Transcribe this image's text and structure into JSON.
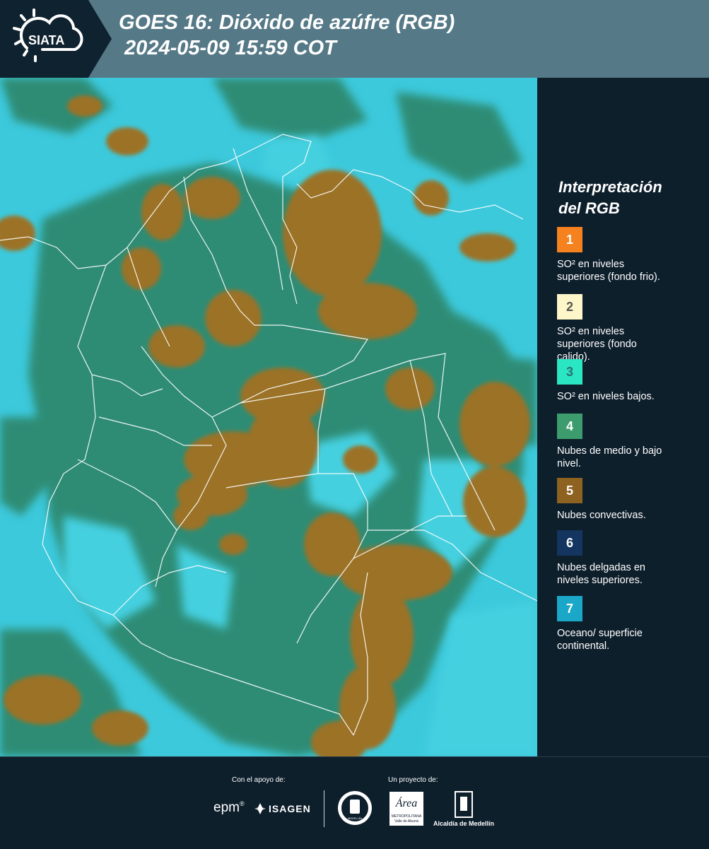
{
  "header": {
    "logo_text": "SIATA",
    "title_line1": "GOES 16: Dióxido de azúfre (RGB)",
    "title_line2": " 2024-05-09 15:59 COT"
  },
  "legend": {
    "title_line1": "Interpretación",
    "title_line2": "del RGB",
    "items": [
      {
        "number": "1",
        "color": "#f6821f",
        "text_color": "#ffffff",
        "label_line1": "SO² en niveles",
        "label_line2": "superiores (fondo frio)."
      },
      {
        "number": "2",
        "color": "#fdf6c8",
        "text_color": "#555555",
        "label_line1": "SO² en niveles",
        "label_line2": "superiores (fondo",
        "label_line3": "calido)."
      },
      {
        "number": "3",
        "color": "#2ae6c2",
        "text_color": "#2e6e6e",
        "label_line1": "SO² en niveles bajos."
      },
      {
        "number": "4",
        "color": "#3c9c6e",
        "text_color": "#ffffff",
        "label_line1": "Nubes de medio y bajo",
        "label_line2": "nivel."
      },
      {
        "number": "5",
        "color": "#8e6220",
        "text_color": "#ffffff",
        "label_line1": "Nubes convectivas."
      },
      {
        "number": "6",
        "color": "#14355f",
        "text_color": "#ffffff",
        "label_line1": "Nubes delgadas en",
        "label_line2": "niveles superiores."
      },
      {
        "number": "7",
        "color": "#1aa7c8",
        "text_color": "#ffffff",
        "label_line1": "Oceano/ superficie",
        "label_line2": "continental."
      }
    ]
  },
  "footer": {
    "support_label": "Con el apoyo de:",
    "project_label": "Un proyecto de:",
    "epm_text": "epm",
    "isagen_text": "ISAGEN",
    "medellin_seal_text": "MEDELLÍN",
    "area_text": "Área",
    "area_sub_text": "METROPOLITANA",
    "area_sub2_text": "Valle de Aburrá",
    "alcaldia_text": "Alcaldía de Medellín"
  },
  "colors": {
    "header_bg": "#557987",
    "dark_bg": "#0e1f2c",
    "ocean_cyan": "#36c6d9",
    "land_green": "#2f8e78",
    "convective_brown": "#9a7228"
  }
}
